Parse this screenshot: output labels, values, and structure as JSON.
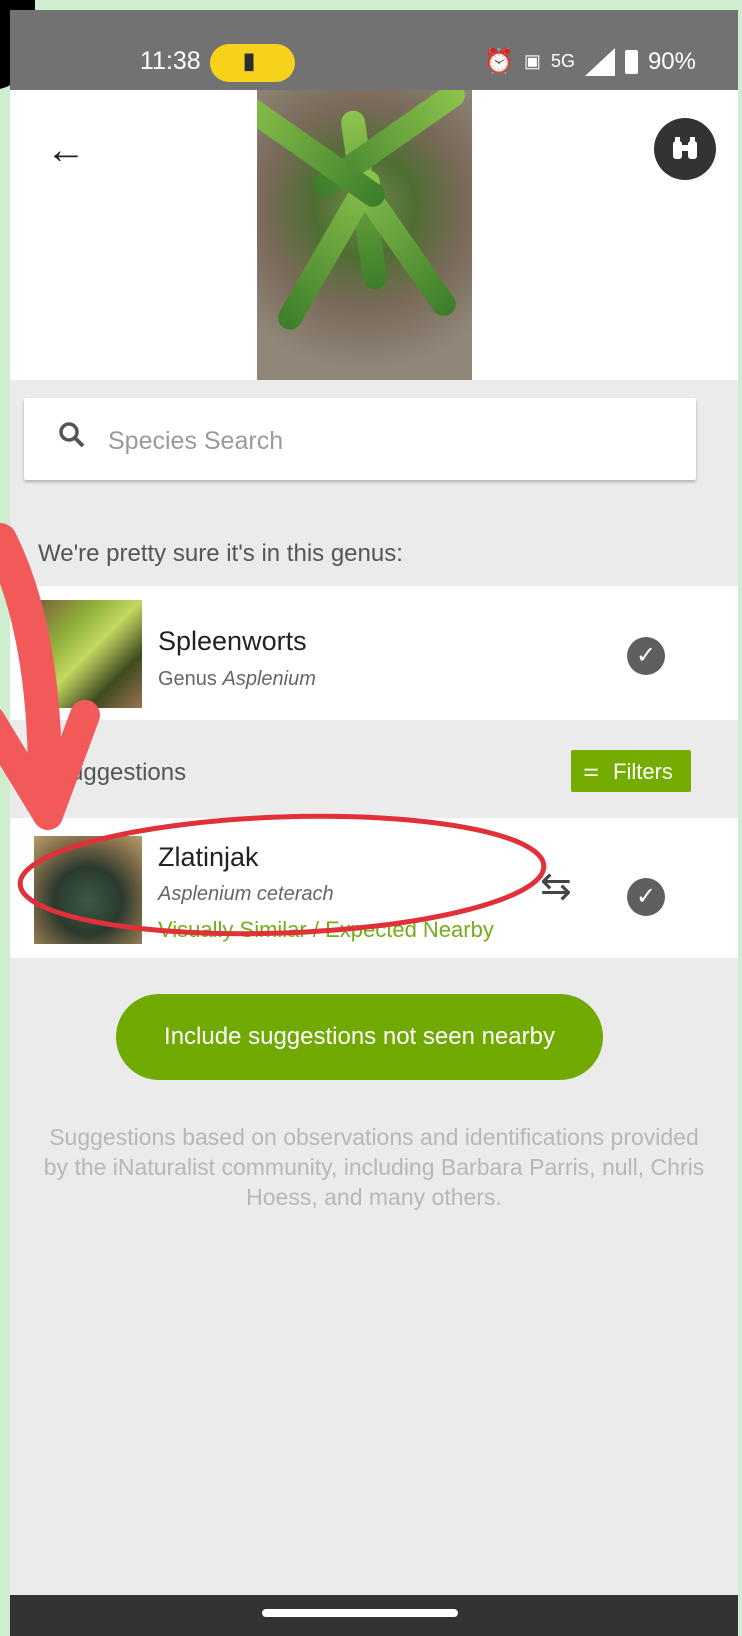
{
  "status_bar": {
    "time": "11:38",
    "battery_pill_icon": "battery-charging-icon",
    "sub_label": "5G",
    "battery_percent": "90%",
    "icons": [
      "alarm-icon",
      "nfc-icon",
      "signal-icon",
      "battery-icon"
    ]
  },
  "header": {
    "back_icon": "←",
    "binoculars_icon": "binoculars-icon"
  },
  "search": {
    "placeholder": "Species Search"
  },
  "genus_section": {
    "label": "We're pretty sure it's in this genus:",
    "item": {
      "common_name": "Spleenworts",
      "rank": "Genus",
      "scientific_name": "Asplenium"
    }
  },
  "suggestions_section": {
    "label": "p suggestions",
    "filters_label": "Filters",
    "items": [
      {
        "common_name": "Zlatinjak",
        "scientific_name": "Asplenium ceterach",
        "note": "Visually Similar / Expected Nearby"
      }
    ]
  },
  "include_button_label": "Include suggestions not seen nearby",
  "footnote": "Suggestions based on observations and identifications provided by the iNaturalist community, including Barbara Parris, null, Chris Hoess, and many others.",
  "colors": {
    "accent_green": "#74ac00",
    "annotation_red": "#e0303a",
    "arrow_red": "#f25a5a"
  }
}
